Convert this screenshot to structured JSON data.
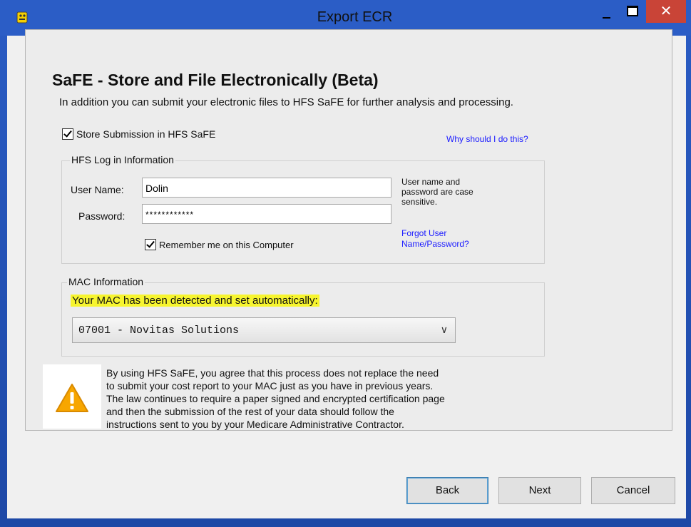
{
  "window": {
    "title": "Export ECR",
    "close_glyph": "✕"
  },
  "header": {
    "title": "SaFE - Store and File Electronically (Beta)",
    "subtitle": "In addition you can submit your electronic files to HFS SaFE for further analysis and processing."
  },
  "store": {
    "checkbox_label": "Store Submission in HFS SaFE",
    "checked": true,
    "why_link": "Why should I do this?"
  },
  "login": {
    "group_title": "HFS Log in Information",
    "username_label": "User Name:",
    "username_value": "Dolin",
    "password_label": "Password:",
    "password_value": "************",
    "hint_line1": "User name and",
    "hint_line2": "password are case",
    "hint_line3": "sensitive.",
    "forgot_line1": "Forgot User",
    "forgot_line2": "Name/Password?",
    "remember_label": "Remember me on this Computer",
    "remember_checked": true
  },
  "mac": {
    "group_title": "MAC Information",
    "detected_text": "Your MAC has been detected and set automatically:",
    "selected": "07001 - Novitas Solutions"
  },
  "notice": {
    "icon": "warning-icon",
    "lines": [
      "By using HFS SaFE, you agree that this process does not replace the need",
      "to submit your cost report to your MAC just as you have in previous years.",
      "The law continues to require a paper signed and encrypted certification page",
      "and then the submission of the rest of your data should follow the",
      "instructions sent to you by your Medicare Administrative Contractor."
    ]
  },
  "footer": {
    "back": "Back",
    "next": "Next",
    "cancel": "Cancel"
  },
  "colors": {
    "accent": "#2b5dc6",
    "close": "#c94437",
    "highlight": "#f7f52f",
    "link": "#1a1aff"
  }
}
